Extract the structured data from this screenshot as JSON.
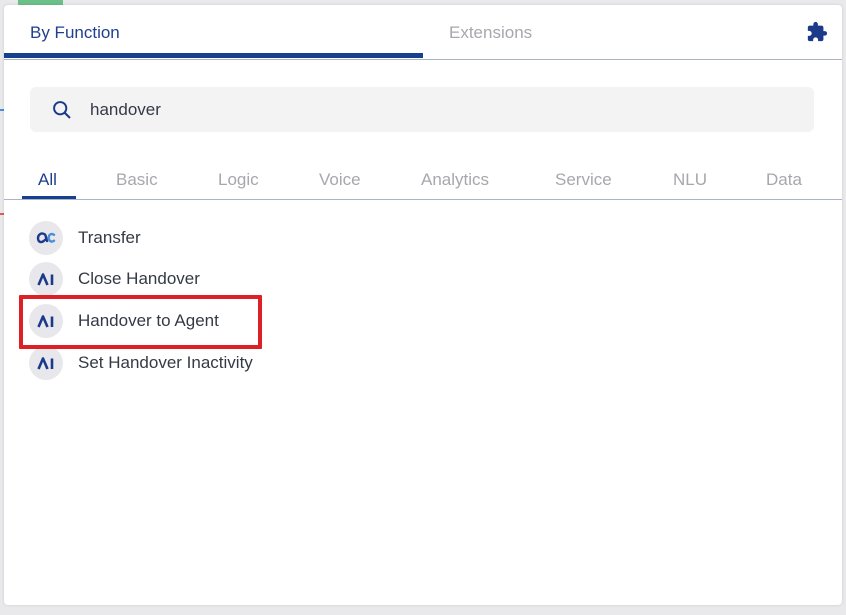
{
  "top_tabs": {
    "by_function": "By Function",
    "extensions": "Extensions"
  },
  "search": {
    "value": "handover"
  },
  "categories": [
    "All",
    "Basic",
    "Logic",
    "Voice",
    "Analytics",
    "Service",
    "NLU",
    "Data"
  ],
  "results": [
    {
      "label": "Transfer",
      "icon": "ac-logo-icon"
    },
    {
      "label": "Close Handover",
      "icon": "ai-logo-icon"
    },
    {
      "label": "Handover to Agent",
      "icon": "ai-logo-icon",
      "highlighted": true
    },
    {
      "label": "Set Handover Inactivity",
      "icon": "ai-logo-icon"
    }
  ],
  "colors": {
    "accent": "#17408f",
    "highlight": "#dd1f26"
  }
}
